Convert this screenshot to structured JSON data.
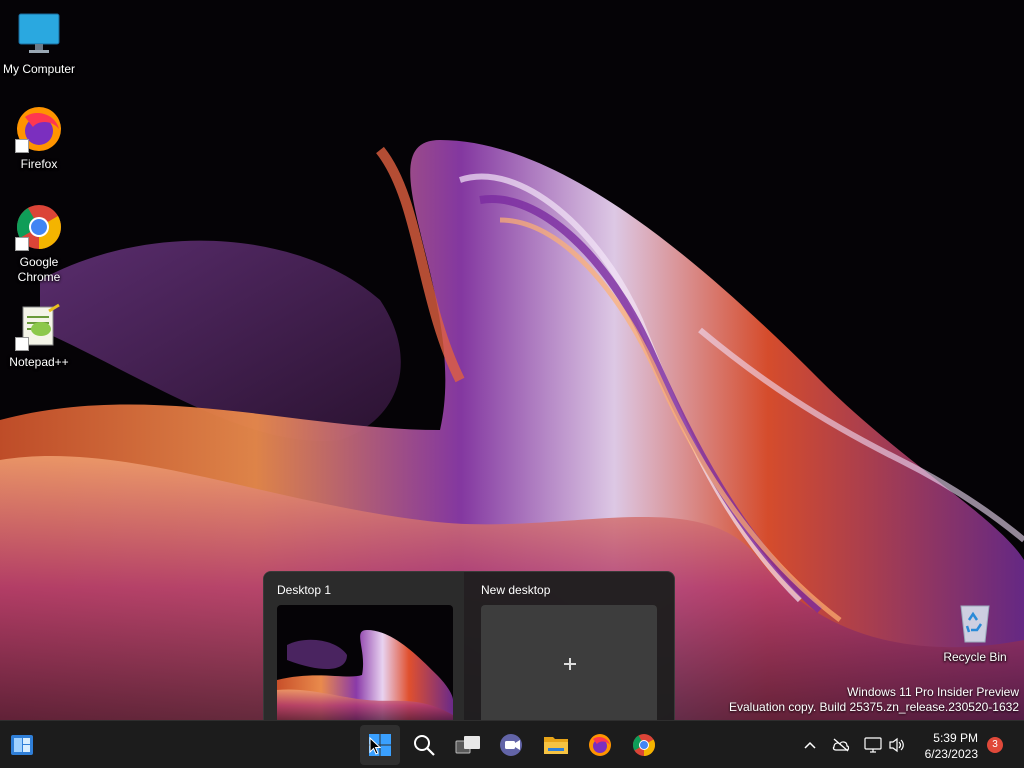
{
  "desktop": {
    "icons": [
      {
        "label": "My Computer"
      },
      {
        "label": "Firefox"
      },
      {
        "label": "Google Chrome"
      },
      {
        "label": "Notepad++"
      },
      {
        "label": "Recycle Bin"
      }
    ],
    "watermark": {
      "line1": "Windows 11 Pro Insider Preview",
      "line2": "Evaluation copy. Build 25375.zn_release.230520-1632"
    }
  },
  "task_view": {
    "desktops": [
      {
        "label": "Desktop 1",
        "current": true
      },
      {
        "label": "New desktop",
        "current": false
      }
    ]
  },
  "taskbar": {
    "left_icon": "widgets-icon",
    "pinned": [
      {
        "name": "start-icon",
        "active": true
      },
      {
        "name": "search-icon"
      },
      {
        "name": "task-view-icon"
      },
      {
        "name": "chat-icon"
      },
      {
        "name": "file-explorer-icon"
      },
      {
        "name": "firefox-icon"
      },
      {
        "name": "chrome-icon"
      }
    ],
    "tray_icons": [
      "chevron-up-icon",
      "network-offline-icon",
      "display-icon",
      "volume-icon"
    ],
    "clock": {
      "time": "5:39 PM",
      "date": "6/23/2023"
    },
    "notification_count": "3"
  },
  "colors": {
    "taskbar_bg": "#1c1c1c",
    "notification_badge": "#e0493a",
    "accent": "#3aa0ff"
  }
}
